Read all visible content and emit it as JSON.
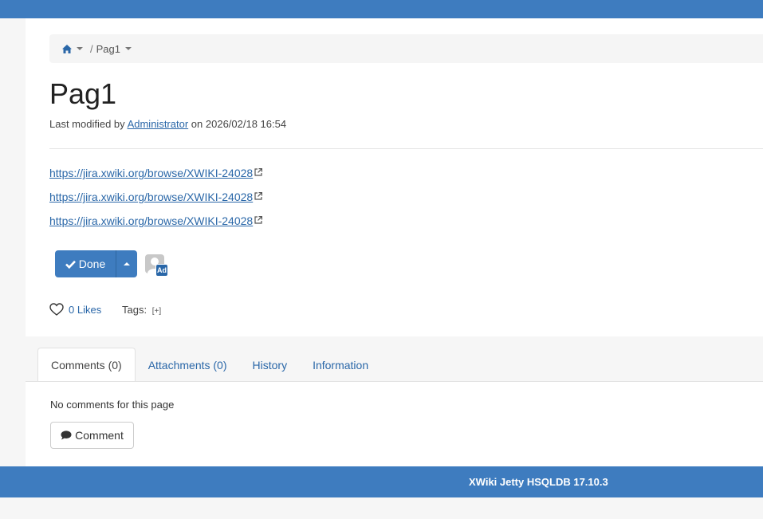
{
  "colors": {
    "brand": "#3e7cbf",
    "link": "#2a67a8"
  },
  "breadcrumb": {
    "home_icon": "home-icon",
    "separator": "/",
    "page": "Pag1"
  },
  "page": {
    "title": "Pag1",
    "meta_prefix": "Last modified by",
    "author": "Administrator",
    "meta_on": "on",
    "date": "2026/02/18 16:54"
  },
  "content": {
    "links": [
      "https://jira.xwiki.org/browse/XWIKI-24028",
      "https://jira.xwiki.org/browse/XWIKI-24028",
      "https://jira.xwiki.org/browse/XWIKI-24028"
    ]
  },
  "actions": {
    "done_label": "Done",
    "avatar_badge": "Ad"
  },
  "social": {
    "likes": "0 Likes",
    "tags_label": "Tags:",
    "tags_add": "[+]"
  },
  "tabs": [
    {
      "label": "Comments (0)",
      "active": true
    },
    {
      "label": "Attachments (0)",
      "active": false
    },
    {
      "label": "History",
      "active": false
    },
    {
      "label": "Information",
      "active": false
    }
  ],
  "comments": {
    "empty_text": "No comments for this page",
    "button_label": "Comment"
  },
  "footer": {
    "text": "XWiki Jetty HSQLDB 17.10.3"
  }
}
